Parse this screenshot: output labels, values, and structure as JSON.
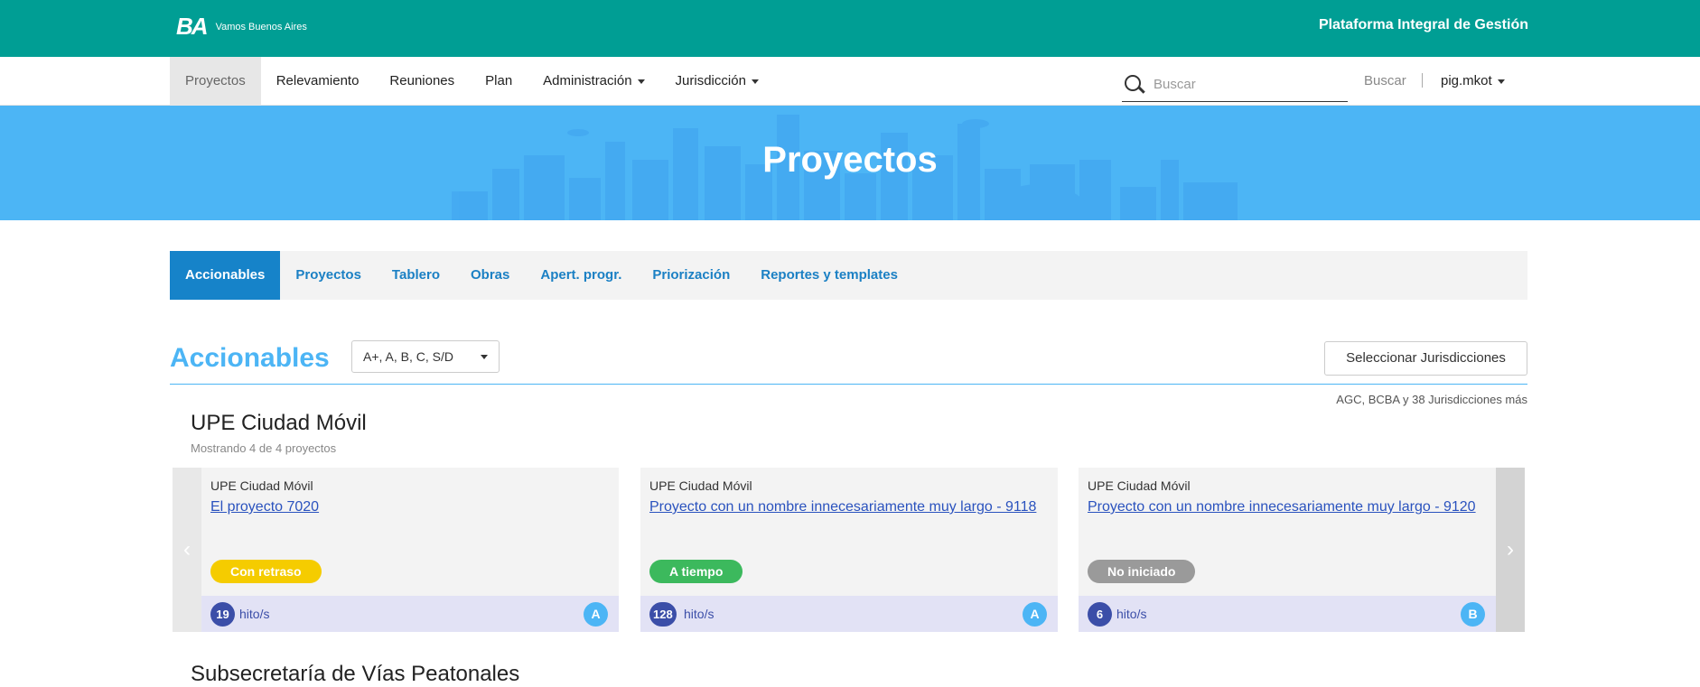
{
  "header": {
    "logo_mark": "BA",
    "logo_tagline": "Vamos Buenos Aires",
    "platform": "Plataforma Integral de Gestión"
  },
  "nav": {
    "items": [
      {
        "label": "Proyectos"
      },
      {
        "label": "Relevamiento"
      },
      {
        "label": "Reuniones"
      },
      {
        "label": "Plan"
      },
      {
        "label": "Administración"
      },
      {
        "label": "Jurisdicción"
      }
    ],
    "search_placeholder": "Buscar",
    "search_button": "Buscar",
    "user": "pig.mkot"
  },
  "hero": {
    "title": "Proyectos"
  },
  "tabs": [
    {
      "label": "Accionables"
    },
    {
      "label": "Proyectos"
    },
    {
      "label": "Tablero"
    },
    {
      "label": "Obras"
    },
    {
      "label": "Apert. progr."
    },
    {
      "label": "Priorización"
    },
    {
      "label": "Reportes y templates"
    }
  ],
  "section": {
    "title": "Accionables",
    "filter_value": "A+, A, B, C, S/D",
    "jur_button": "Seleccionar Jurisdicciones",
    "jur_note": "AGC, BCBA y 38 Jurisdicciones más"
  },
  "group": {
    "title": "UPE Ciudad Móvil",
    "subtitle": "Mostrando 4 de 4 proyectos",
    "cards": [
      {
        "org": "UPE Ciudad Móvil",
        "name": "El proyecto 7020",
        "status": "Con retraso",
        "status_color": "#f5cc00",
        "count": "19",
        "hitos": "hito/s",
        "grade": "A"
      },
      {
        "org": "UPE Ciudad Móvil",
        "name": "Proyecto con un nombre innecesariamente muy largo - 9118",
        "status": "A tiempo",
        "status_color": "#3cb95d",
        "count": "128",
        "hitos": "hito/s",
        "grade": "A"
      },
      {
        "org": "UPE Ciudad Móvil",
        "name": "Proyecto con un nombre innecesariamente muy largo - 9120",
        "status": "No iniciado",
        "status_color": "#9a9a9a",
        "count": "6",
        "hitos": "hito/s",
        "grade": "B"
      }
    ]
  },
  "next_group": {
    "title": "Subsecretaría de Vías Peatonales"
  },
  "icons": {
    "search": "search-icon",
    "prev": "chevron-left-icon",
    "next": "chevron-right-icon"
  },
  "colors": {
    "topbar": "#009e94",
    "hero": "#4cb5f5",
    "tab_active": "#1683c9",
    "link": "#2a52be"
  }
}
